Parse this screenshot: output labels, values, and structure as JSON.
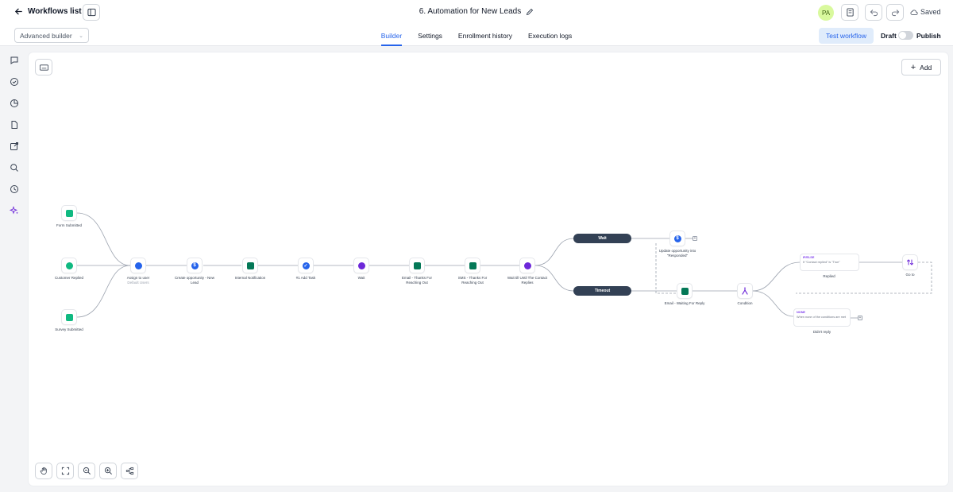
{
  "header": {
    "back_label": "Workflows list",
    "title": "6. Automation for New Leads",
    "avatar_initials": "PA",
    "saved_label": "Saved"
  },
  "subheader": {
    "builder_mode": "Advanced builder",
    "tabs": [
      {
        "label": "Builder",
        "active": true
      },
      {
        "label": "Settings",
        "active": false
      },
      {
        "label": "Enrollment history",
        "active": false
      },
      {
        "label": "Execution logs",
        "active": false
      }
    ],
    "test_label": "Test workflow",
    "draft_label": "Draft",
    "publish_label": "Publish"
  },
  "canvas": {
    "add_label": "Add",
    "triggers": [
      {
        "label": "Form Submitted"
      },
      {
        "label": "Customer Replied"
      },
      {
        "label": "Survey Submitted"
      }
    ],
    "steps": [
      {
        "label": "Assign to user",
        "sub": "Default Users"
      },
      {
        "label": "Create opportunity - New Lead"
      },
      {
        "label": "Internal Notification"
      },
      {
        "label": "#1 Add Task"
      },
      {
        "label": "Wait"
      },
      {
        "label": "Email - Thanks For Reaching Out"
      },
      {
        "label": "SMS - Thanks For Reaching Out"
      },
      {
        "label": "Wait till Until The Contact Replies"
      }
    ],
    "branches": {
      "wait_label": "Wait",
      "timeout_label": "Timeout",
      "update_opp_label": "Update opportunity into \"Responded\"",
      "email_waiting_label": "Email - Waiting For Reply",
      "condition_label": "Condition",
      "replied_tag": "IF/ELSE",
      "replied_text": "If \"Contact replied\" is \"True\"",
      "replied_label": "Replied",
      "none_tag": "NONE",
      "none_text": "When none of the conditions are met",
      "none_label": "Didn't reply",
      "goto_label": "Go to"
    }
  },
  "colors": {
    "accent": "#2563eb",
    "pill_dark": "#334155",
    "icon_green": "#10b981",
    "icon_blue": "#2563eb",
    "icon_purple": "#6d28d9",
    "icon_teal": "#047857"
  }
}
